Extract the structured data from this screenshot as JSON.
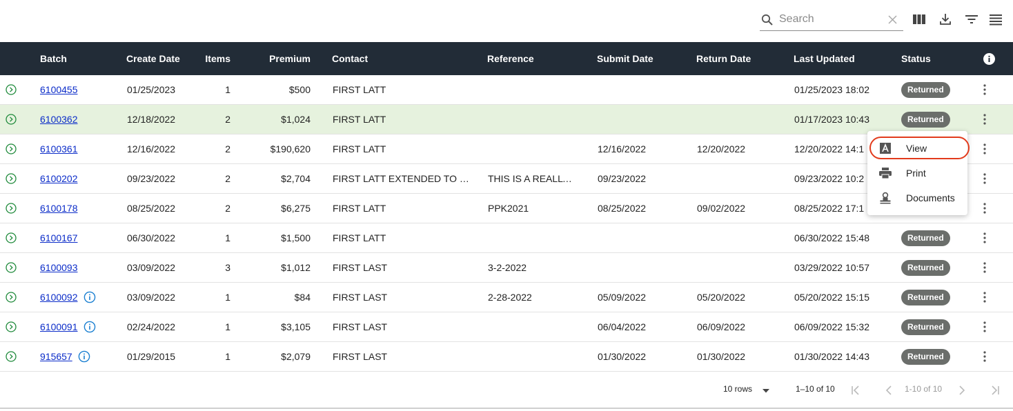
{
  "toolbar": {
    "search_placeholder": "Search",
    "icons": [
      "search-icon",
      "clear-icon",
      "columns-icon",
      "download-icon",
      "filter-icon",
      "density-icon"
    ]
  },
  "columns": {
    "batch": "Batch",
    "create_date": "Create Date",
    "items": "Items",
    "premium": "Premium",
    "contact": "Contact",
    "reference": "Reference",
    "submit_date": "Submit Date",
    "return_date": "Return Date",
    "last_updated": "Last Updated",
    "status": "Status"
  },
  "rows": [
    {
      "batch": "6100455",
      "create_date": "01/25/2023",
      "items": "1",
      "premium": "$500",
      "contact": "FIRST LATT",
      "reference": "",
      "submit_date": "",
      "return_date": "",
      "last_updated": "01/25/2023 18:02",
      "status": "Returned"
    },
    {
      "batch": "6100362",
      "create_date": "12/18/2022",
      "items": "2",
      "premium": "$1,024",
      "contact": "FIRST LATT",
      "reference": "",
      "submit_date": "",
      "return_date": "",
      "last_updated": "01/17/2023 10:43",
      "status": "Returned"
    },
    {
      "batch": "6100361",
      "create_date": "12/16/2022",
      "items": "2",
      "premium": "$190,620",
      "contact": "FIRST LATT",
      "reference": "",
      "submit_date": "12/16/2022",
      "return_date": "12/20/2022",
      "last_updated": "12/20/2022 14:1",
      "status": ""
    },
    {
      "batch": "6100202",
      "create_date": "09/23/2022",
      "items": "2",
      "premium": "$2,704",
      "contact": "FIRST LATT EXTENDED TO B...",
      "reference": "THIS IS A REALLY ...",
      "submit_date": "09/23/2022",
      "return_date": "",
      "last_updated": "09/23/2022 10:2",
      "status": ""
    },
    {
      "batch": "6100178",
      "create_date": "08/25/2022",
      "items": "2",
      "premium": "$6,275",
      "contact": "FIRST LATT",
      "reference": "PPK2021",
      "submit_date": "08/25/2022",
      "return_date": "09/02/2022",
      "last_updated": "08/25/2022 17:1",
      "status": ""
    },
    {
      "batch": "6100167",
      "create_date": "06/30/2022",
      "items": "1",
      "premium": "$1,500",
      "contact": "FIRST LATT",
      "reference": "",
      "submit_date": "",
      "return_date": "",
      "last_updated": "06/30/2022 15:48",
      "status": "Returned"
    },
    {
      "batch": "6100093",
      "create_date": "03/09/2022",
      "items": "3",
      "premium": "$1,012",
      "contact": "FIRST LAST",
      "reference": "3-2-2022",
      "submit_date": "",
      "return_date": "",
      "last_updated": "03/29/2022 10:57",
      "status": "Returned"
    },
    {
      "batch": "6100092",
      "create_date": "03/09/2022",
      "items": "1",
      "premium": "$84",
      "contact": "FIRST LAST",
      "reference": "2-28-2022",
      "submit_date": "05/09/2022",
      "return_date": "05/20/2022",
      "last_updated": "05/20/2022 15:15",
      "status": "Returned",
      "info": true
    },
    {
      "batch": "6100091",
      "create_date": "02/24/2022",
      "items": "1",
      "premium": "$3,105",
      "contact": "FIRST LAST",
      "reference": "",
      "submit_date": "06/04/2022",
      "return_date": "06/09/2022",
      "last_updated": "06/09/2022 15:32",
      "status": "Returned",
      "info": true
    },
    {
      "batch": "915657",
      "create_date": "01/29/2015",
      "items": "1",
      "premium": "$2,079",
      "contact": "FIRST LAST",
      "reference": "",
      "submit_date": "01/30/2022",
      "return_date": "01/30/2022",
      "last_updated": "01/30/2022 14:43",
      "status": "Returned",
      "info": true
    }
  ],
  "selected_row": 1,
  "menu": {
    "items": [
      {
        "label": "View",
        "icon": "view-icon"
      },
      {
        "label": "Print",
        "icon": "print-icon"
      },
      {
        "label": "Documents",
        "icon": "documents-icon"
      }
    ]
  },
  "footer": {
    "rows_per_page": "10 rows",
    "range": "1–10 of 10",
    "range_small": "1-10 of 10"
  },
  "colors": {
    "header_bg": "#222c37",
    "selected_row_bg": "#e6f2de",
    "badge_bg": "#6b6e6b",
    "link": "#0b2cc9",
    "expand_icon": "#1f8a3b",
    "info_icon": "#1a7fd1",
    "highlight_ring": "#e23b1c"
  }
}
